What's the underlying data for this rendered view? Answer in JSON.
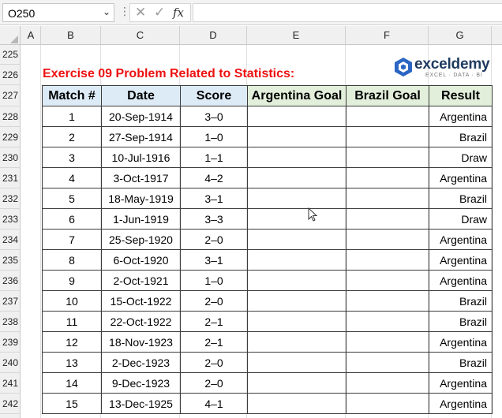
{
  "formula_bar": {
    "name_box": "O250",
    "name_box_arrow": "⌄",
    "separator": "⋮",
    "cancel_glyph": "✕",
    "enter_glyph": "✓",
    "fx_label": "fx",
    "formula": ""
  },
  "columns": [
    "A",
    "B",
    "C",
    "D",
    "E",
    "F",
    "G"
  ],
  "rows": [
    "225",
    "226",
    "227",
    "228",
    "229",
    "230",
    "231",
    "232",
    "233",
    "234",
    "235",
    "236",
    "237",
    "238",
    "239",
    "240",
    "241",
    "242"
  ],
  "sheet": {
    "title": "Exercise 09 Problem Related to Statistics:",
    "title_color": "#ee1111",
    "logo": {
      "name": "exceldemy",
      "tagline": "EXCEL · DATA · BI",
      "brand_color": "#1f3a5f",
      "icon": "exceldemy-logo-icon"
    },
    "table": {
      "headers": [
        "Match #",
        "Date",
        "Score",
        "Argentina Goal",
        "Brazil Goal",
        "Result"
      ],
      "header_colors": {
        "blue": "#ddebf7",
        "green": "#e2efda"
      },
      "rows": [
        [
          "1",
          "20-Sep-1914",
          "3–0",
          "",
          "",
          "Argentina"
        ],
        [
          "2",
          "27-Sep-1914",
          "1–0",
          "",
          "",
          "Brazil"
        ],
        [
          "3",
          "10-Jul-1916",
          "1–1",
          "",
          "",
          "Draw"
        ],
        [
          "4",
          "3-Oct-1917",
          "4–2",
          "",
          "",
          "Argentina"
        ],
        [
          "5",
          "18-May-1919",
          "3–1",
          "",
          "",
          "Brazil"
        ],
        [
          "6",
          "1-Jun-1919",
          "3–3",
          "",
          "",
          "Draw"
        ],
        [
          "7",
          "25-Sep-1920",
          "2–0",
          "",
          "",
          "Argentina"
        ],
        [
          "8",
          "6-Oct-1920",
          "3–1",
          "",
          "",
          "Argentina"
        ],
        [
          "9",
          "2-Oct-1921",
          "1–0",
          "",
          "",
          "Argentina"
        ],
        [
          "10",
          "15-Oct-1922",
          "2–0",
          "",
          "",
          "Brazil"
        ],
        [
          "11",
          "22-Oct-1922",
          "2–1",
          "",
          "",
          "Brazil"
        ],
        [
          "12",
          "18-Nov-1923",
          "2–1",
          "",
          "",
          "Argentina"
        ],
        [
          "13",
          "2-Dec-1923",
          "2–0",
          "",
          "",
          "Brazil"
        ],
        [
          "14",
          "9-Dec-1923",
          "2–0",
          "",
          "",
          "Argentina"
        ],
        [
          "15",
          "13-Dec-1925",
          "4–1",
          "",
          "",
          "Argentina"
        ]
      ]
    }
  }
}
